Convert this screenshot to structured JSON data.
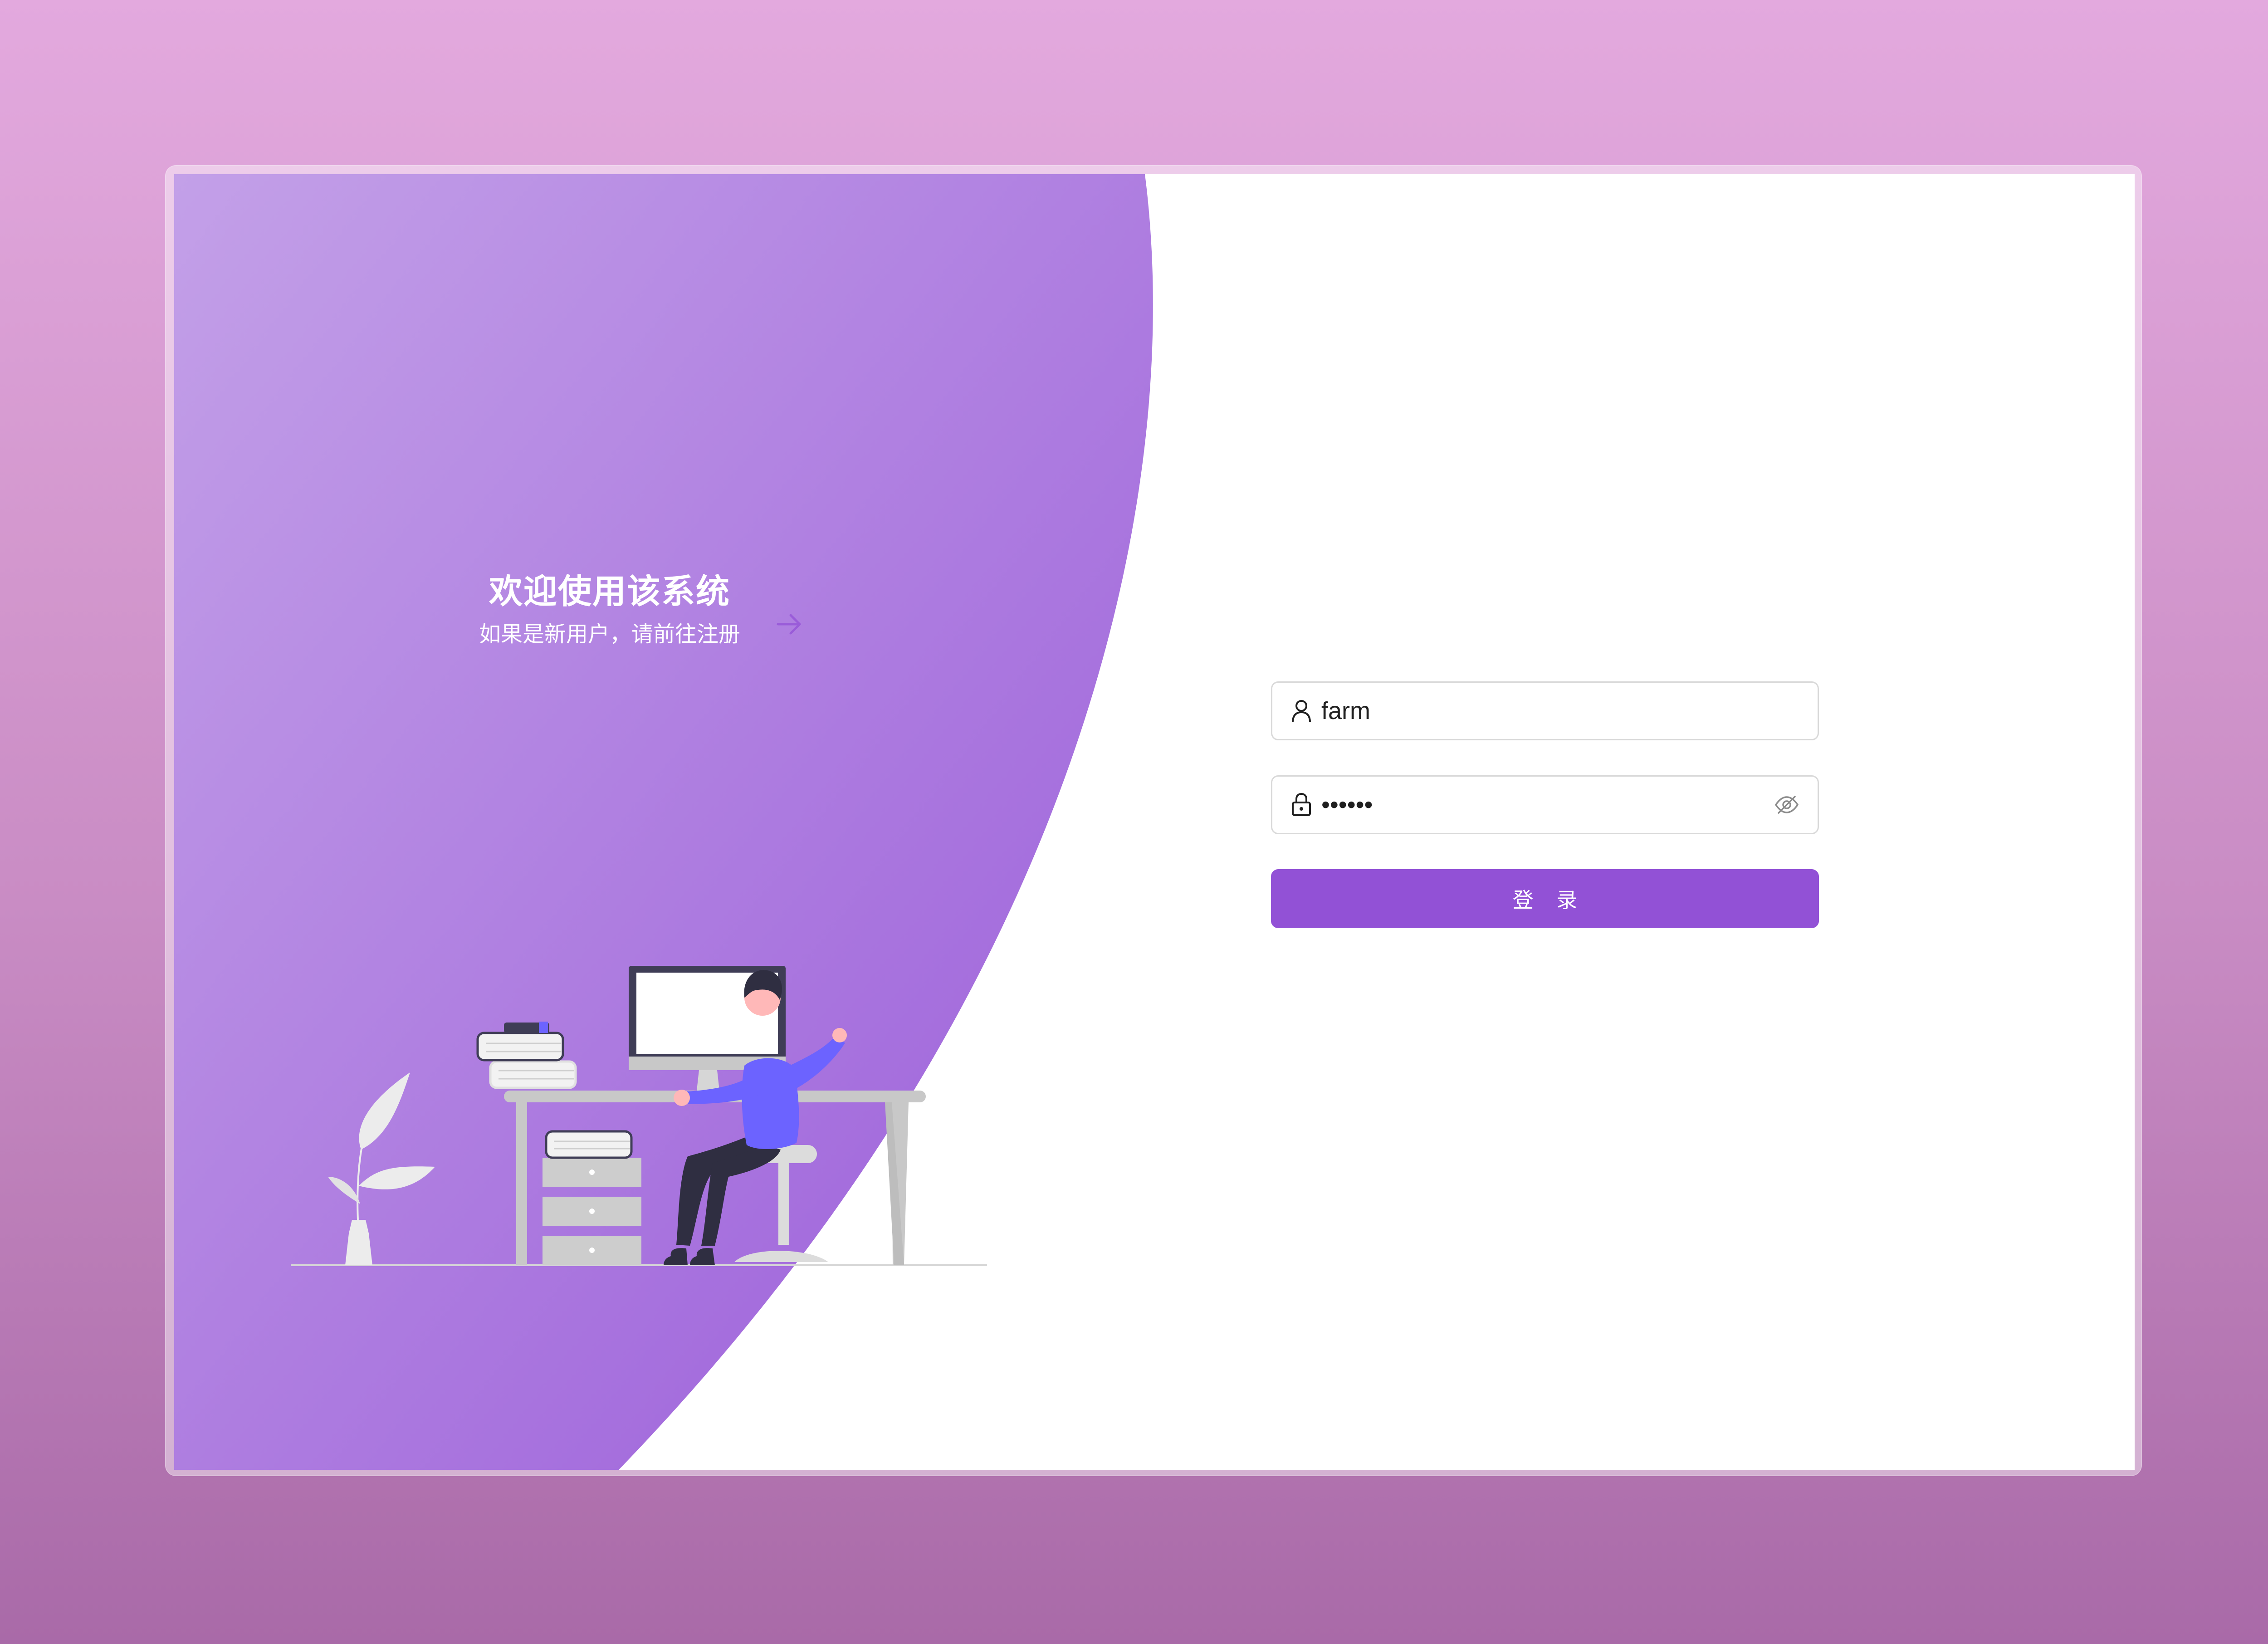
{
  "welcome": {
    "title": "欢迎使用该系统",
    "subtitle": "如果是新用户，请前往注册"
  },
  "login_form": {
    "username_value": "farm",
    "password_value": "farm12",
    "login_label": "登 录"
  },
  "icons": {
    "register": "arrow-right-icon",
    "username": "user-icon",
    "password": "lock-icon",
    "toggle_visibility": "eye-slash-icon"
  },
  "colors": {
    "page_bg_top": "#e3a9de",
    "page_bg_bottom": "#a96aa8",
    "panel_light": "#c3a0e8",
    "panel_dark": "#9f64db",
    "button": "#9251d6",
    "person_shirt": "#6c63ff"
  }
}
